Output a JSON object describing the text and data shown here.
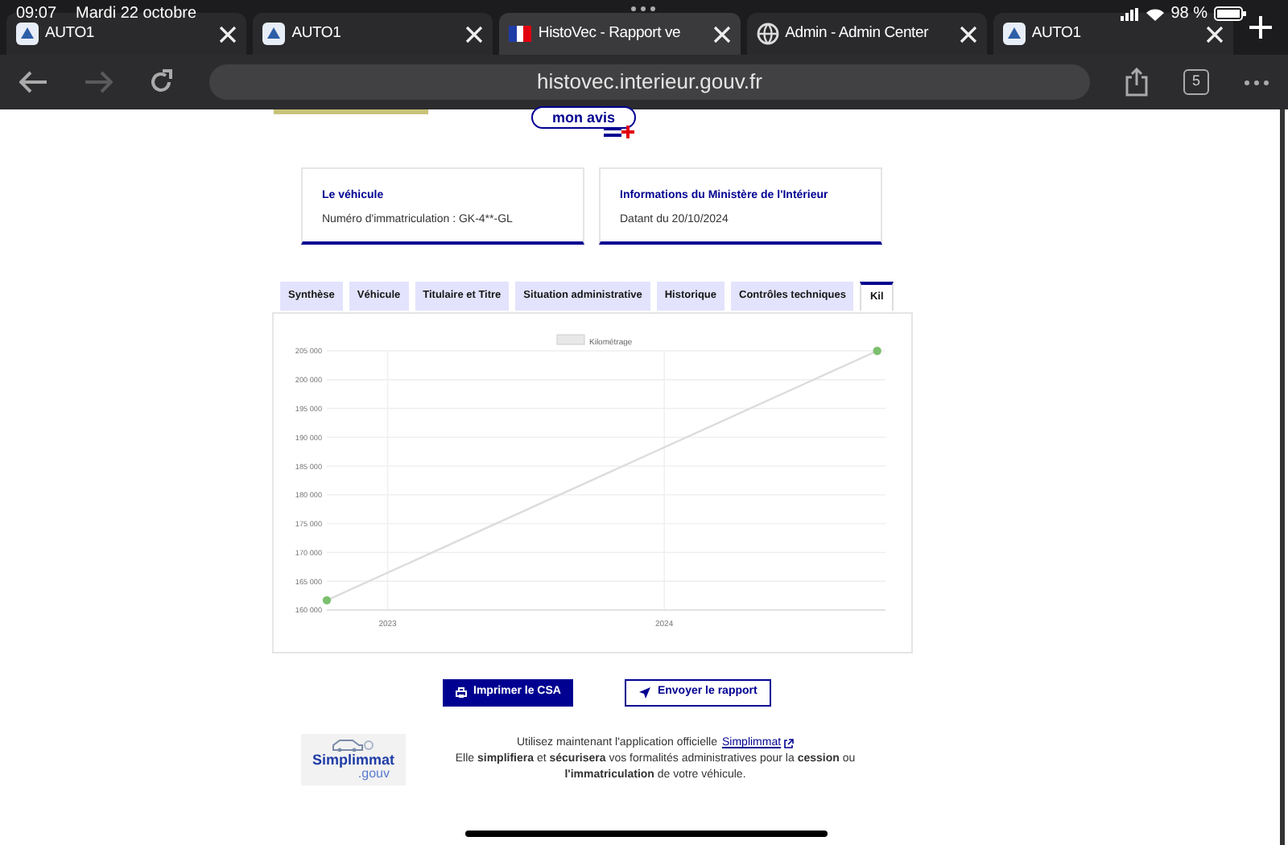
{
  "status_bar": {
    "time": "09:07",
    "date": "Mardi 22 octobre",
    "battery": "98 %"
  },
  "browser_tabs": [
    {
      "title": "AUTO1",
      "kind": "app",
      "selected": false
    },
    {
      "title": "AUTO1",
      "kind": "app",
      "selected": false
    },
    {
      "title": "HistoVec - Rapport ve",
      "kind": "flag",
      "selected": true
    },
    {
      "title": "Admin - Admin Center",
      "kind": "globe",
      "selected": false
    },
    {
      "title": "AUTO1",
      "kind": "app",
      "selected": false
    }
  ],
  "address_bar": {
    "url": "histovec.interieur.gouv.fr"
  },
  "tab_count": "5",
  "feedback_button": {
    "label": "mon avis"
  },
  "info_cards": [
    {
      "title": "Le véhicule",
      "text": "Numéro d'immatriculation : GK-4**-GL"
    },
    {
      "title": "Informations du Ministère de l'Intérieur",
      "text": "Datant du 20/10/2024"
    }
  ],
  "tabs": [
    {
      "label": "Synthèse",
      "selected": false
    },
    {
      "label": "Véhicule",
      "selected": false
    },
    {
      "label": "Titulaire et Titre",
      "selected": false
    },
    {
      "label": "Situation administrative",
      "selected": false
    },
    {
      "label": "Historique",
      "selected": false
    },
    {
      "label": "Contrôles techniques",
      "selected": false
    },
    {
      "label": "Kil",
      "selected": true
    }
  ],
  "chart": {
    "chart_data": {
      "type": "line",
      "x": [
        2022.78,
        2024.77
      ],
      "series": [
        {
          "name": "Kilométrage",
          "color": "#7cbf6e",
          "values": [
            161700,
            205000
          ]
        }
      ],
      "grid": true,
      "marker": true,
      "xlim": [
        2022.78,
        2024.8
      ],
      "ylim": [
        160000,
        205000
      ],
      "xticks": [
        2023,
        2024
      ],
      "yticks": [
        {
          "value": 160000,
          "label": "160 000"
        },
        {
          "value": 165000,
          "label": "165 000"
        },
        {
          "value": 170000,
          "label": "170 000"
        },
        {
          "value": 175000,
          "label": "175 000"
        },
        {
          "value": 180000,
          "label": "180 000"
        },
        {
          "value": 185000,
          "label": "185 000"
        },
        {
          "value": 190000,
          "label": "190 000"
        },
        {
          "value": 195000,
          "label": "195 000"
        },
        {
          "value": 200000,
          "label": "200 000"
        },
        {
          "value": 205000,
          "label": "205 000"
        }
      ]
    }
  },
  "buttons": [
    {
      "label": "Imprimer le CSA",
      "kind": "primary"
    },
    {
      "label": "Envoyer le rapport",
      "kind": "secondary"
    }
  ],
  "promo": {
    "logo_main": "Simplimmat",
    "logo_sub": ".gouv",
    "line_1": "Utilisez maintenant l'application officielle",
    "link": "Simplimmat",
    "line_2": "Elle **simplifiera** et **sécurisera** vos formalités administratives pour la **cession** ou **l'immatriculation** de votre véhicule."
  }
}
